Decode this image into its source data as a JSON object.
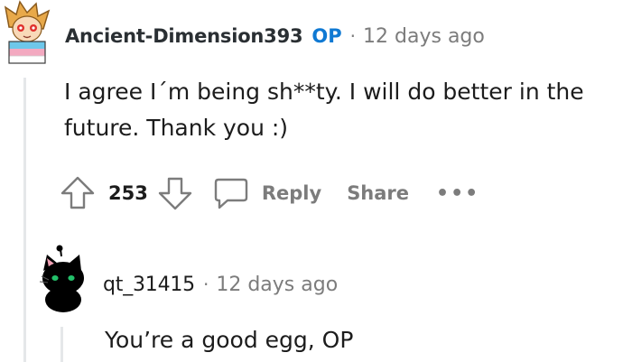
{
  "comment": {
    "author": "Ancient-Dimension393",
    "op_badge": "OP",
    "separator": "·",
    "time": "12 days ago",
    "body": "I agree I´m being sh**ty. I will do better in the future. Thank you :)",
    "score": "253",
    "reply_label": "Reply",
    "share_label": "Share",
    "more_label": "•••",
    "avatar_icon": "cartoon-character-avatar-icon"
  },
  "reply": {
    "author": "qt_31415",
    "separator": "·",
    "time": "12 days ago",
    "body": "You’re a good egg, OP",
    "avatar_icon": "black-cat-avatar-icon"
  },
  "colors": {
    "op_badge": "#0f79d3",
    "muted": "#7c7c7c",
    "thread_line": "#e5e7e9"
  }
}
